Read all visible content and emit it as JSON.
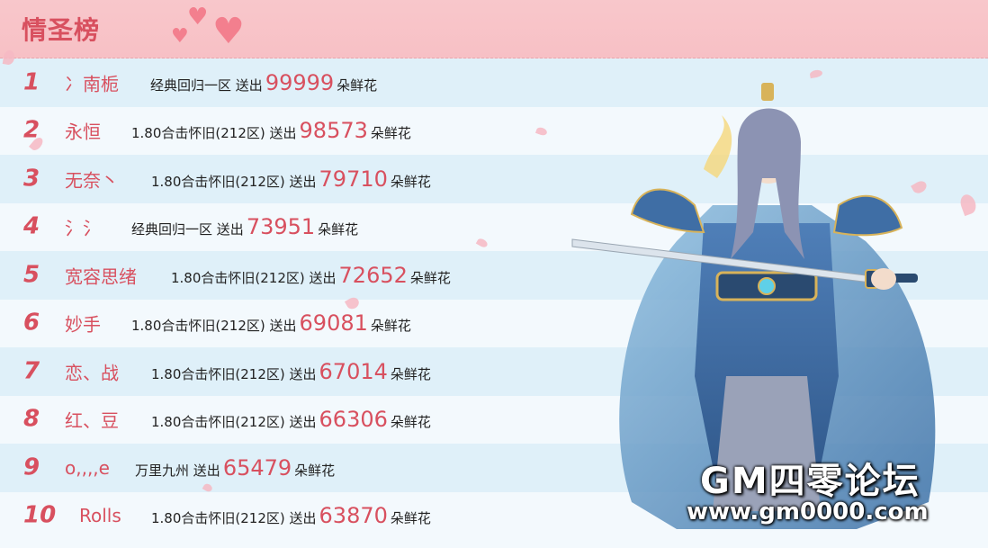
{
  "header": {
    "title": "情圣榜"
  },
  "rows": [
    {
      "rank": "1",
      "name": "冫南栀",
      "server": "经典回归一区",
      "sent": "送出",
      "count": "99999",
      "unit": "朵鲜花"
    },
    {
      "rank": "2",
      "name": "永恒",
      "server": "1.80合击怀旧(212区)",
      "sent": "送出",
      "count": "98573",
      "unit": "朵鲜花"
    },
    {
      "rank": "3",
      "name": "无奈丶",
      "server": "1.80合击怀旧(212区)",
      "sent": "送出",
      "count": "79710",
      "unit": "朵鲜花"
    },
    {
      "rank": "4",
      "name": "氵氵",
      "server": "经典回归一区",
      "sent": "送出",
      "count": "73951",
      "unit": "朵鲜花"
    },
    {
      "rank": "5",
      "name": "宽容思绪",
      "server": "1.80合击怀旧(212区)",
      "sent": "送出",
      "count": "72652",
      "unit": "朵鲜花"
    },
    {
      "rank": "6",
      "name": "妙手",
      "server": "1.80合击怀旧(212区)",
      "sent": "送出",
      "count": "69081",
      "unit": "朵鲜花"
    },
    {
      "rank": "7",
      "name": "恋、战",
      "server": "1.80合击怀旧(212区)",
      "sent": "送出",
      "count": "67014",
      "unit": "朵鲜花"
    },
    {
      "rank": "8",
      "name": "红、豆",
      "server": "1.80合击怀旧(212区)",
      "sent": "送出",
      "count": "66306",
      "unit": "朵鲜花"
    },
    {
      "rank": "9",
      "name": "o,,,,e",
      "server": "万里九州",
      "sent": "送出",
      "count": "65479",
      "unit": "朵鲜花"
    },
    {
      "rank": "10",
      "name": "Rolls",
      "server": "1.80合击怀旧(212区)",
      "sent": "送出",
      "count": "63870",
      "unit": "朵鲜花"
    }
  ],
  "watermark": {
    "title": "GM四零论坛",
    "url": "www.gm0000.com"
  },
  "colors": {
    "accent": "#d8505f",
    "header_bg": "#f8c7cb",
    "row_odd": "#dff0f9",
    "row_even": "#f3f9fd"
  }
}
